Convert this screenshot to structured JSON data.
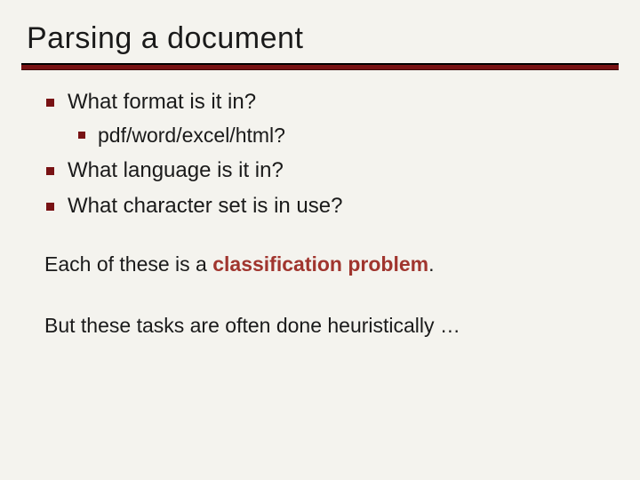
{
  "title": "Parsing a document",
  "bullets": {
    "item1": "What format is it in?",
    "item1_sub1": "pdf/word/excel/html?",
    "item2": "What language is it in?",
    "item3": "What character set is in use?"
  },
  "para1_prefix": "Each of these is a ",
  "para1_emph": "classification problem",
  "para1_suffix": ".",
  "para2": "But these tasks are often done heuristically …"
}
